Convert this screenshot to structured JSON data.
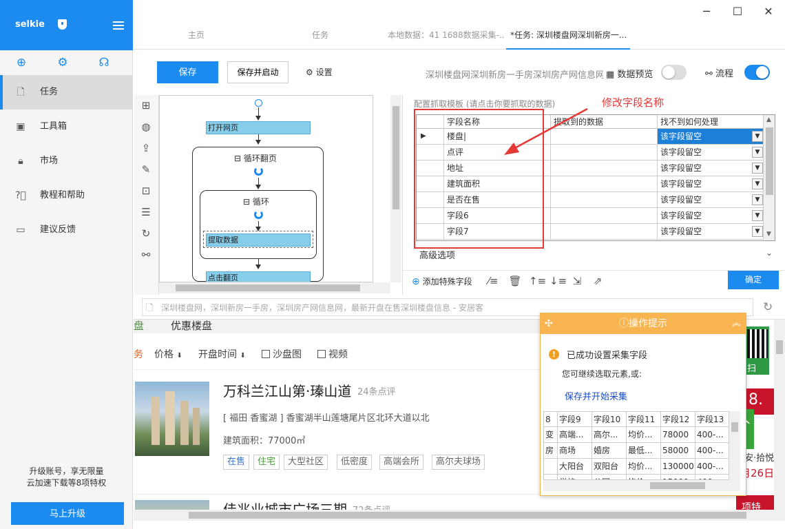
{
  "app": {
    "brand": "selkie",
    "promo_line1": "升级账号，享无限量",
    "promo_line2": "云加速下载等8项特权",
    "upgrade_label": "马上升级"
  },
  "sidebar": {
    "items": [
      {
        "label": "任务",
        "icon": "file-icon"
      },
      {
        "label": "工具箱",
        "icon": "briefcase-icon"
      },
      {
        "label": "市场",
        "icon": "lock-icon"
      },
      {
        "label": "教程和帮助",
        "icon": "help-circle-icon"
      },
      {
        "label": "建议反馈",
        "icon": "comment-icon"
      }
    ]
  },
  "tabs": [
    "主页",
    "任务",
    "本地数据：41 1688数据采集-...",
    "*任务: 深圳楼盘网深圳新房一..."
  ],
  "toolbar": {
    "save_label": "保存",
    "save_start_label": "保存并启动",
    "settings_label": "设置",
    "task_title": "深圳楼盘网深圳新房一手房深圳房产网信息网",
    "preview_label": "数据预览",
    "flow_label": "流程",
    "preview_on": false,
    "flow_on": true
  },
  "flow": {
    "open_page": "打开网页",
    "loop_page": "循环翻页",
    "loop": "循环",
    "extract": "提取数据",
    "click_next": "点击翻页"
  },
  "config": {
    "title": "配置抓取模板 (请点击你要抓取的数据)",
    "annotation": "修改字段名称",
    "headers": [
      "字段名称",
      "提取到的数据",
      "找不到如何处理"
    ],
    "rows": [
      {
        "name": "楼盘",
        "data": "",
        "handling": "该字段留空"
      },
      {
        "name": "点评",
        "data": "",
        "handling": "该字段留空"
      },
      {
        "name": "地址",
        "data": "",
        "handling": "该字段留空"
      },
      {
        "name": "建筑面积",
        "data": "",
        "handling": "该字段留空"
      },
      {
        "name": "是否在售",
        "data": "",
        "handling": "该字段留空"
      },
      {
        "name": "字段6",
        "data": "",
        "handling": "该字段留空"
      },
      {
        "name": "字段7",
        "data": "",
        "handling": "该字段留空"
      }
    ],
    "advanced": "高级选项",
    "add_special": "添加特殊字段",
    "ok": "确定"
  },
  "browser": {
    "url": "深圳楼盘网，深圳新房一手房，深圳房产网信息网，最新开盘在售深圳楼盘信息 - 安居客"
  },
  "listing": {
    "tab_a": "盘",
    "tab_b": "优惠楼盘",
    "filters": [
      "务",
      "价格",
      "开盘时间",
      "沙盘图",
      "视频"
    ],
    "item1": {
      "title": "万科兰江山第·瑧山道",
      "reviews": "24条点评",
      "address": "[ 福田 香蜜湖 ] 香蜜湖半山莲塘尾片区北环大道以北",
      "area": "建筑面积：77000㎡",
      "tags": [
        "在售",
        "住宅",
        "大型社区",
        "低密度",
        "高端会所",
        "高尔夫球场"
      ]
    },
    "item2": {
      "title": "佳兆业城市广场三期",
      "reviews": "72条点评"
    },
    "right_ads": [
      "扫",
      "8.",
      "安·拾悦",
      "月26日",
      "项特"
    ]
  },
  "popup": {
    "title": "操作提示",
    "message": "已成功设置采集字段",
    "sub": "您可继续选取元素,或:",
    "link": "保存并开始采集",
    "headers": [
      "8",
      "字段9",
      "字段10",
      "字段11",
      "字段12",
      "字段13"
    ],
    "rows": [
      [
        "变",
        "高端...",
        "高尔...",
        "均价...",
        "78000",
        "400-..."
      ],
      [
        "房",
        "商场",
        "婚房",
        "最低...",
        "58000",
        "400-..."
      ],
      [
        "",
        "大阳台",
        "双阳台",
        "均价...",
        "130000",
        "400-..."
      ],
      [
        "",
        "学校",
        "公园",
        "均价...",
        "15000",
        "400-..."
      ]
    ]
  }
}
